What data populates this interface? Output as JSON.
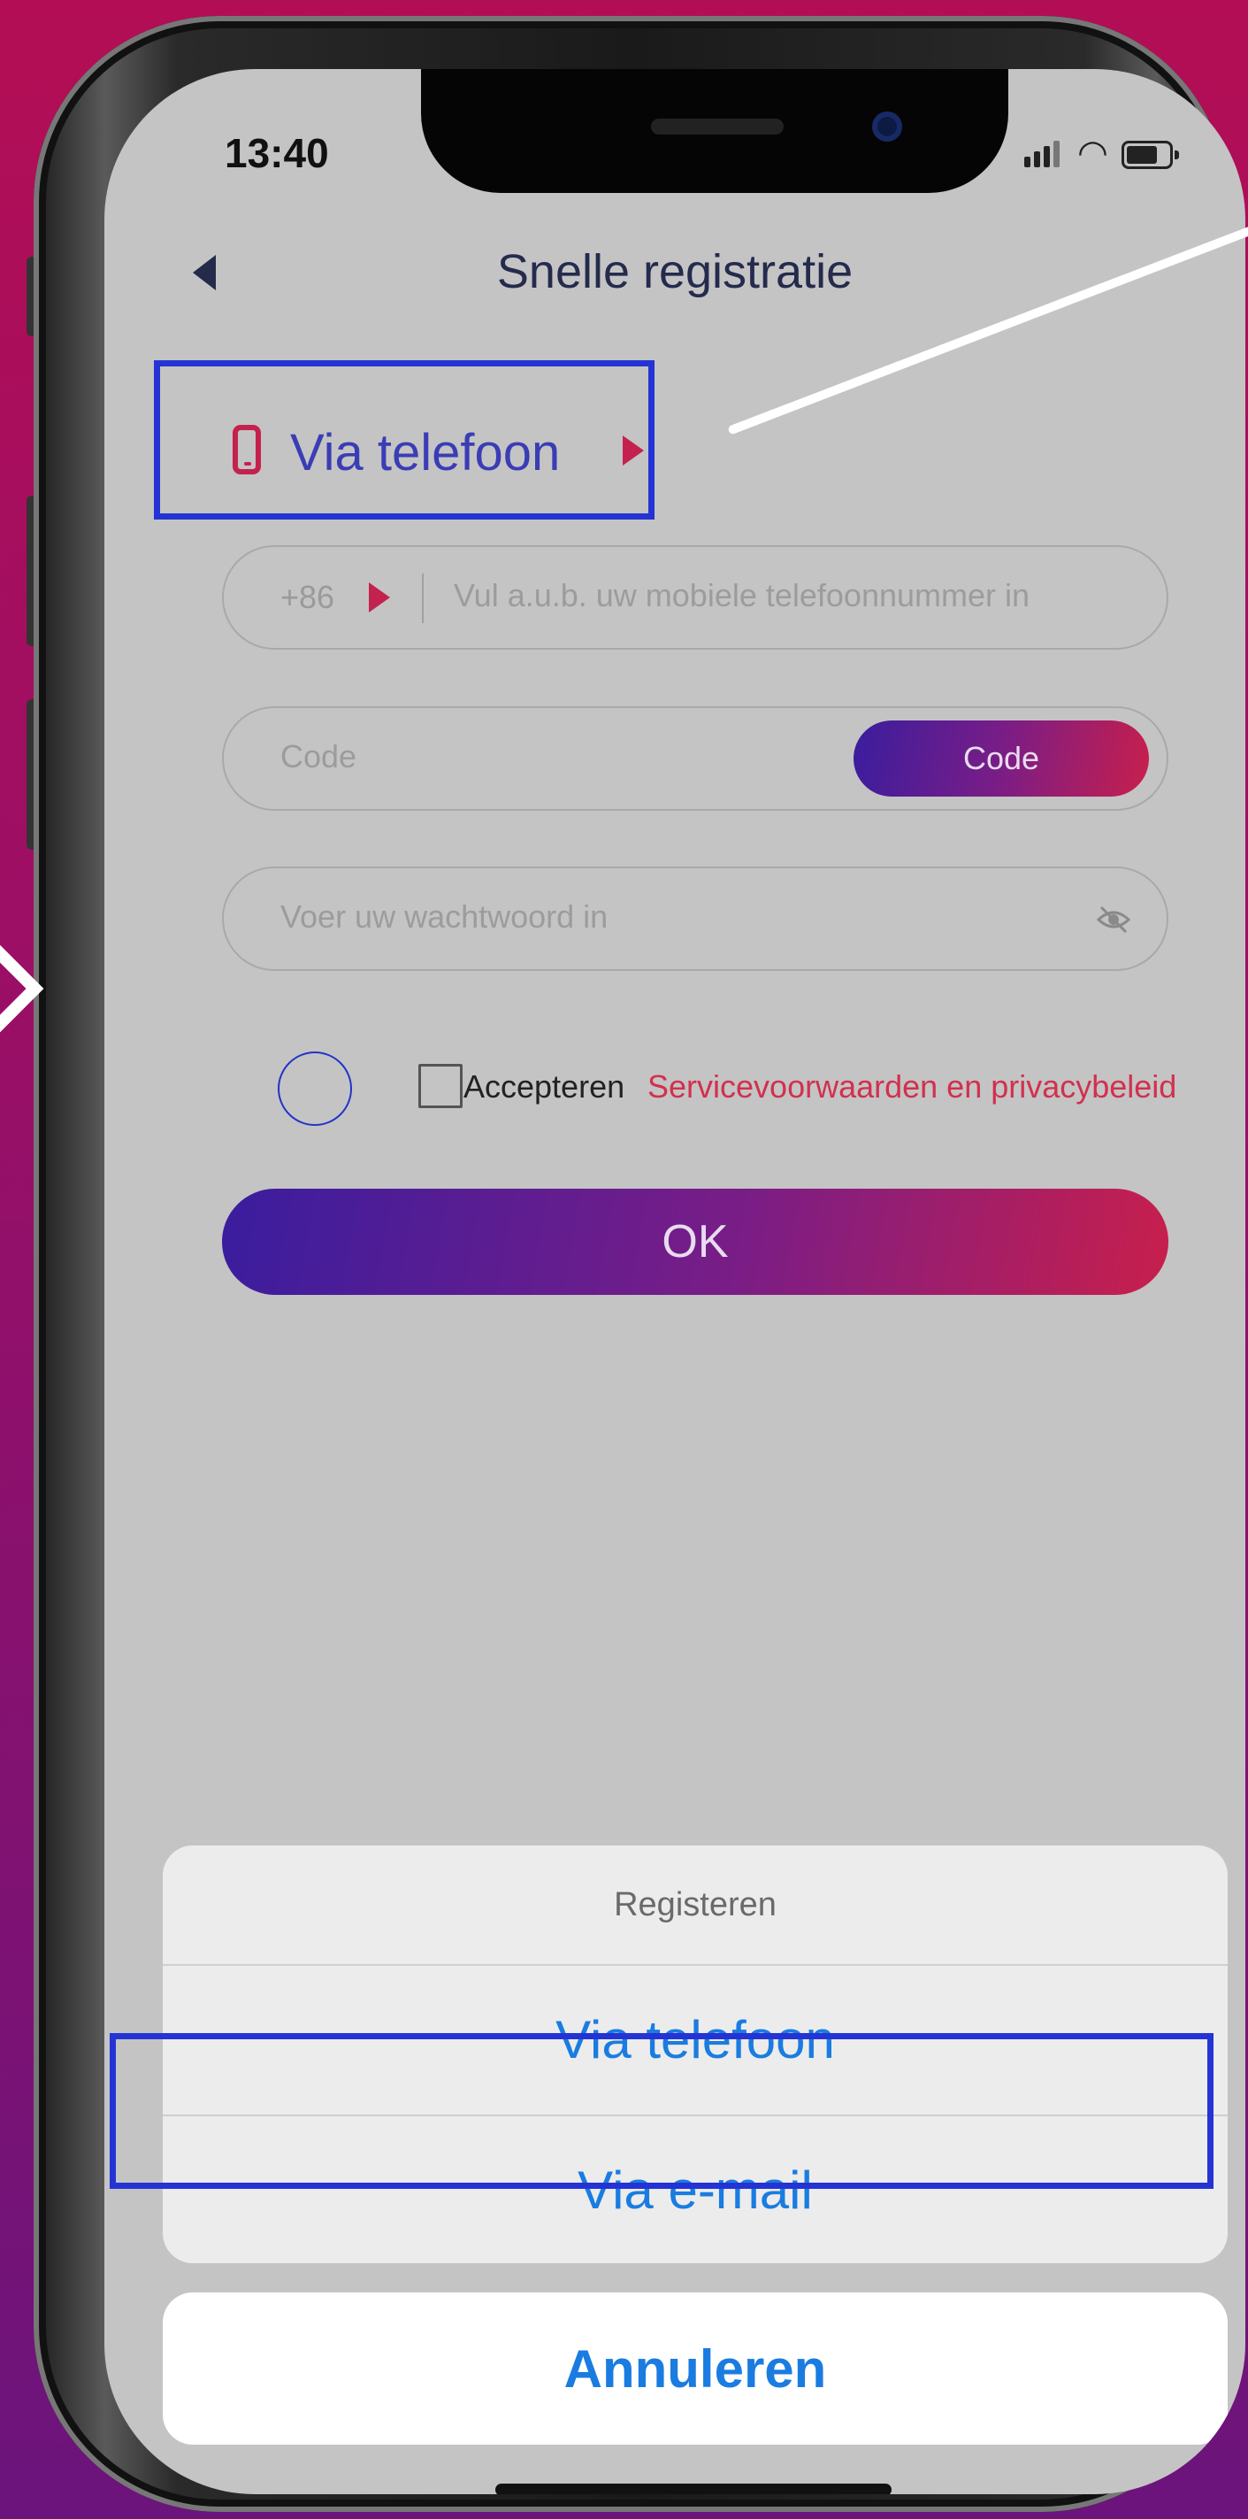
{
  "status_bar": {
    "time": "13:40"
  },
  "header": {
    "title": "Snelle registratie"
  },
  "registration_method": {
    "label": "Via telefoon"
  },
  "phone_field": {
    "country_code": "+86",
    "placeholder": "Vul a.u.b. uw mobiele telefoonnummer in"
  },
  "code_field": {
    "placeholder": "Code",
    "button_label": "Code"
  },
  "password_field": {
    "placeholder": "Voer uw wachtwoord in"
  },
  "terms": {
    "accept_label": "Accepteren",
    "link_label": "Servicevoorwaarden en privacybeleid",
    "checked": false
  },
  "ok_button": {
    "label": "OK"
  },
  "action_sheet": {
    "title": "Registeren",
    "options": [
      {
        "label": "Via telefoon"
      },
      {
        "label": "Via e-mail"
      }
    ],
    "cancel_label": "Annuleren"
  },
  "colors": {
    "accent_red": "#c4224e",
    "accent_purple": "#3a3db5",
    "ios_blue": "#1a7ce0",
    "highlight_blue": "#2434d4"
  }
}
